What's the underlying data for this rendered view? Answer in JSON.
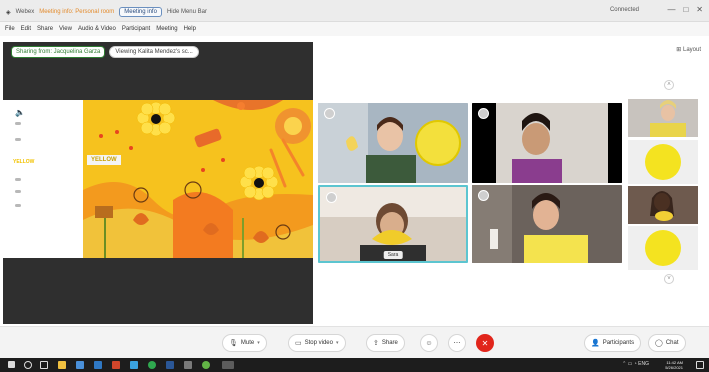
{
  "window": {
    "app_title": "Webex",
    "meeting_info": "Meeting info: Personal room",
    "meeting_pill": "Meeting info",
    "hide_menu": "Hide Menu Bar",
    "connected": "Connected",
    "controls": [
      "—",
      "□",
      "✕"
    ]
  },
  "menu": {
    "items": [
      "File",
      "Edit",
      "Share",
      "View",
      "Audio & Video",
      "Participant",
      "Meeting",
      "Help"
    ]
  },
  "share": {
    "sharing_from": "Sharing from: Jacquelina Garza",
    "viewing": "Viewing Kalita Mendez's sc..."
  },
  "slide": {
    "word": "YELLOW",
    "label": "YELLOW"
  },
  "video": {
    "main_chip": "Sara"
  },
  "layout": {
    "label": "Layout"
  },
  "controls": {
    "mute": "Mute",
    "stop_video": "Stop video",
    "share": "Share",
    "participants": "Participants",
    "chat": "Chat"
  },
  "taskbar": {
    "time": "11:42 AM",
    "date": "5/26/2021"
  },
  "colors": {
    "accent_end": "#e1251b",
    "speaker_border": "#5cc5d0",
    "slide_yellow": "#f6c21e"
  }
}
